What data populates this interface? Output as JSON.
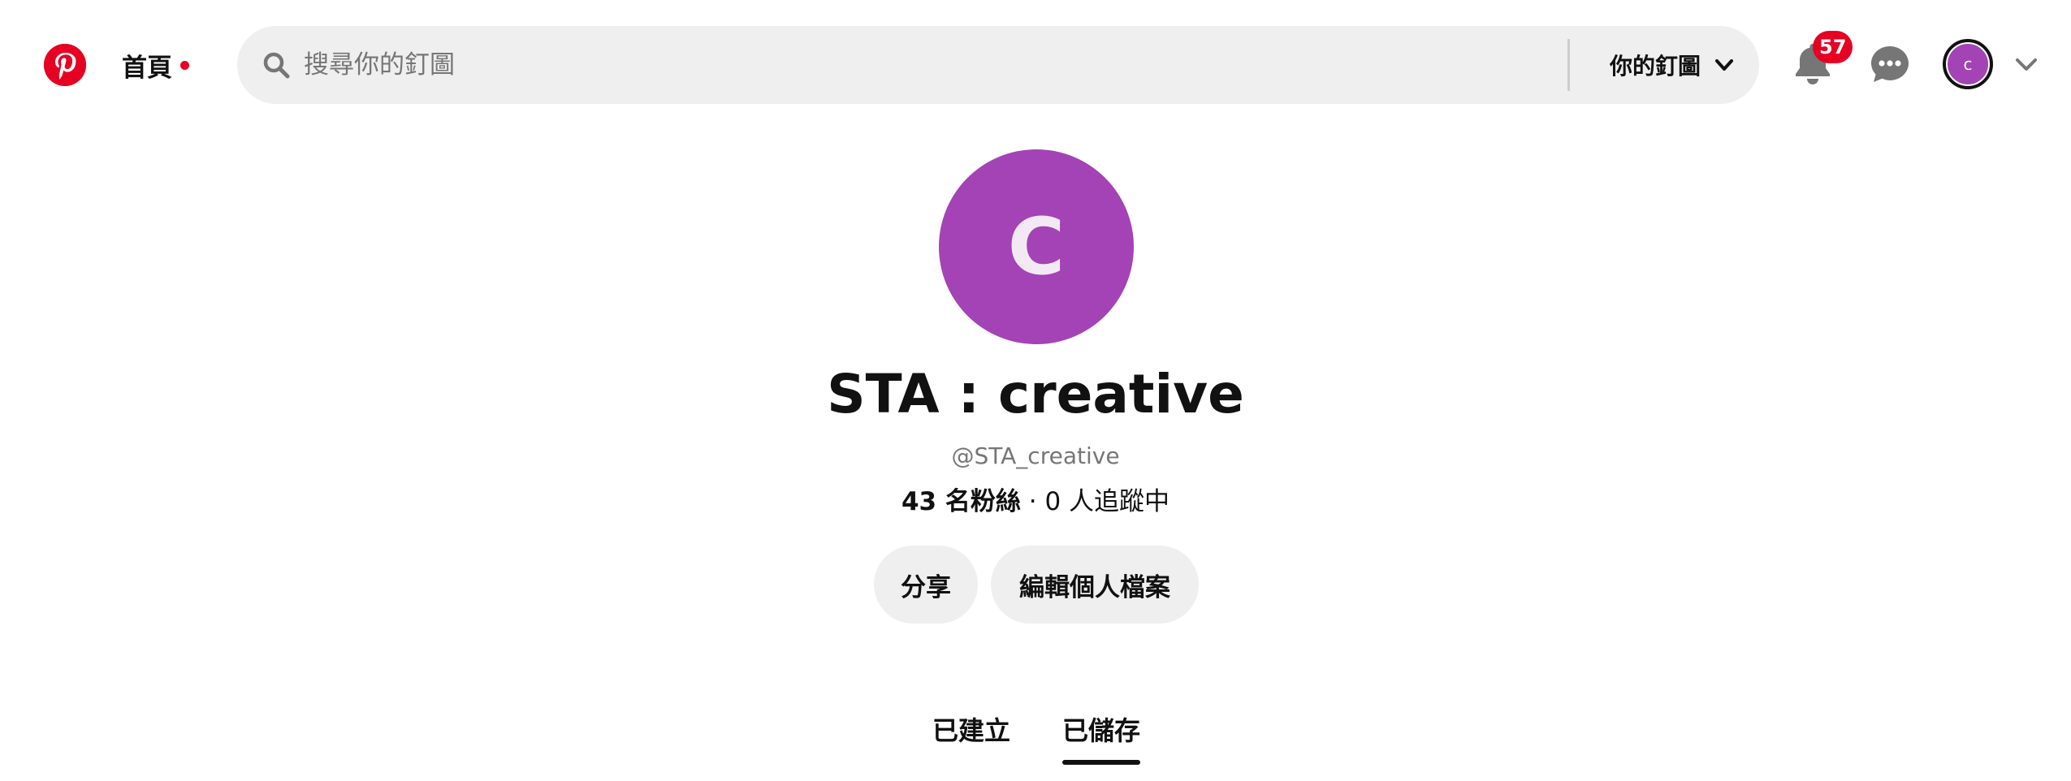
{
  "header": {
    "home_label": "首頁",
    "search": {
      "placeholder": "搜尋你的釘圖",
      "value": ""
    },
    "scope_label": "你的釘圖",
    "notification_count": "57",
    "account_initial": "c"
  },
  "profile": {
    "avatar_initial": "C",
    "name": "STA : creative",
    "handle": "@STA_creative",
    "followers": "43 名粉絲",
    "separator": "·",
    "following": "0 人追蹤中"
  },
  "actions": {
    "share_label": "分享",
    "edit_label": "編輯個人檔案"
  },
  "tabs": [
    {
      "label": "已建立",
      "active": false
    },
    {
      "label": "已儲存",
      "active": true
    }
  ],
  "icons": {
    "logo": "pinterest-logo-icon",
    "search": "search-icon",
    "scope_chevron": "chevron-down-icon",
    "notifications": "bell-icon",
    "messages": "chat-bubble-icon",
    "account_chevron": "chevron-down-icon"
  },
  "colors": {
    "brand": "#e60023",
    "avatar": "#a443b5",
    "surface": "#efefef",
    "text": "#111111",
    "muted": "#767676"
  }
}
